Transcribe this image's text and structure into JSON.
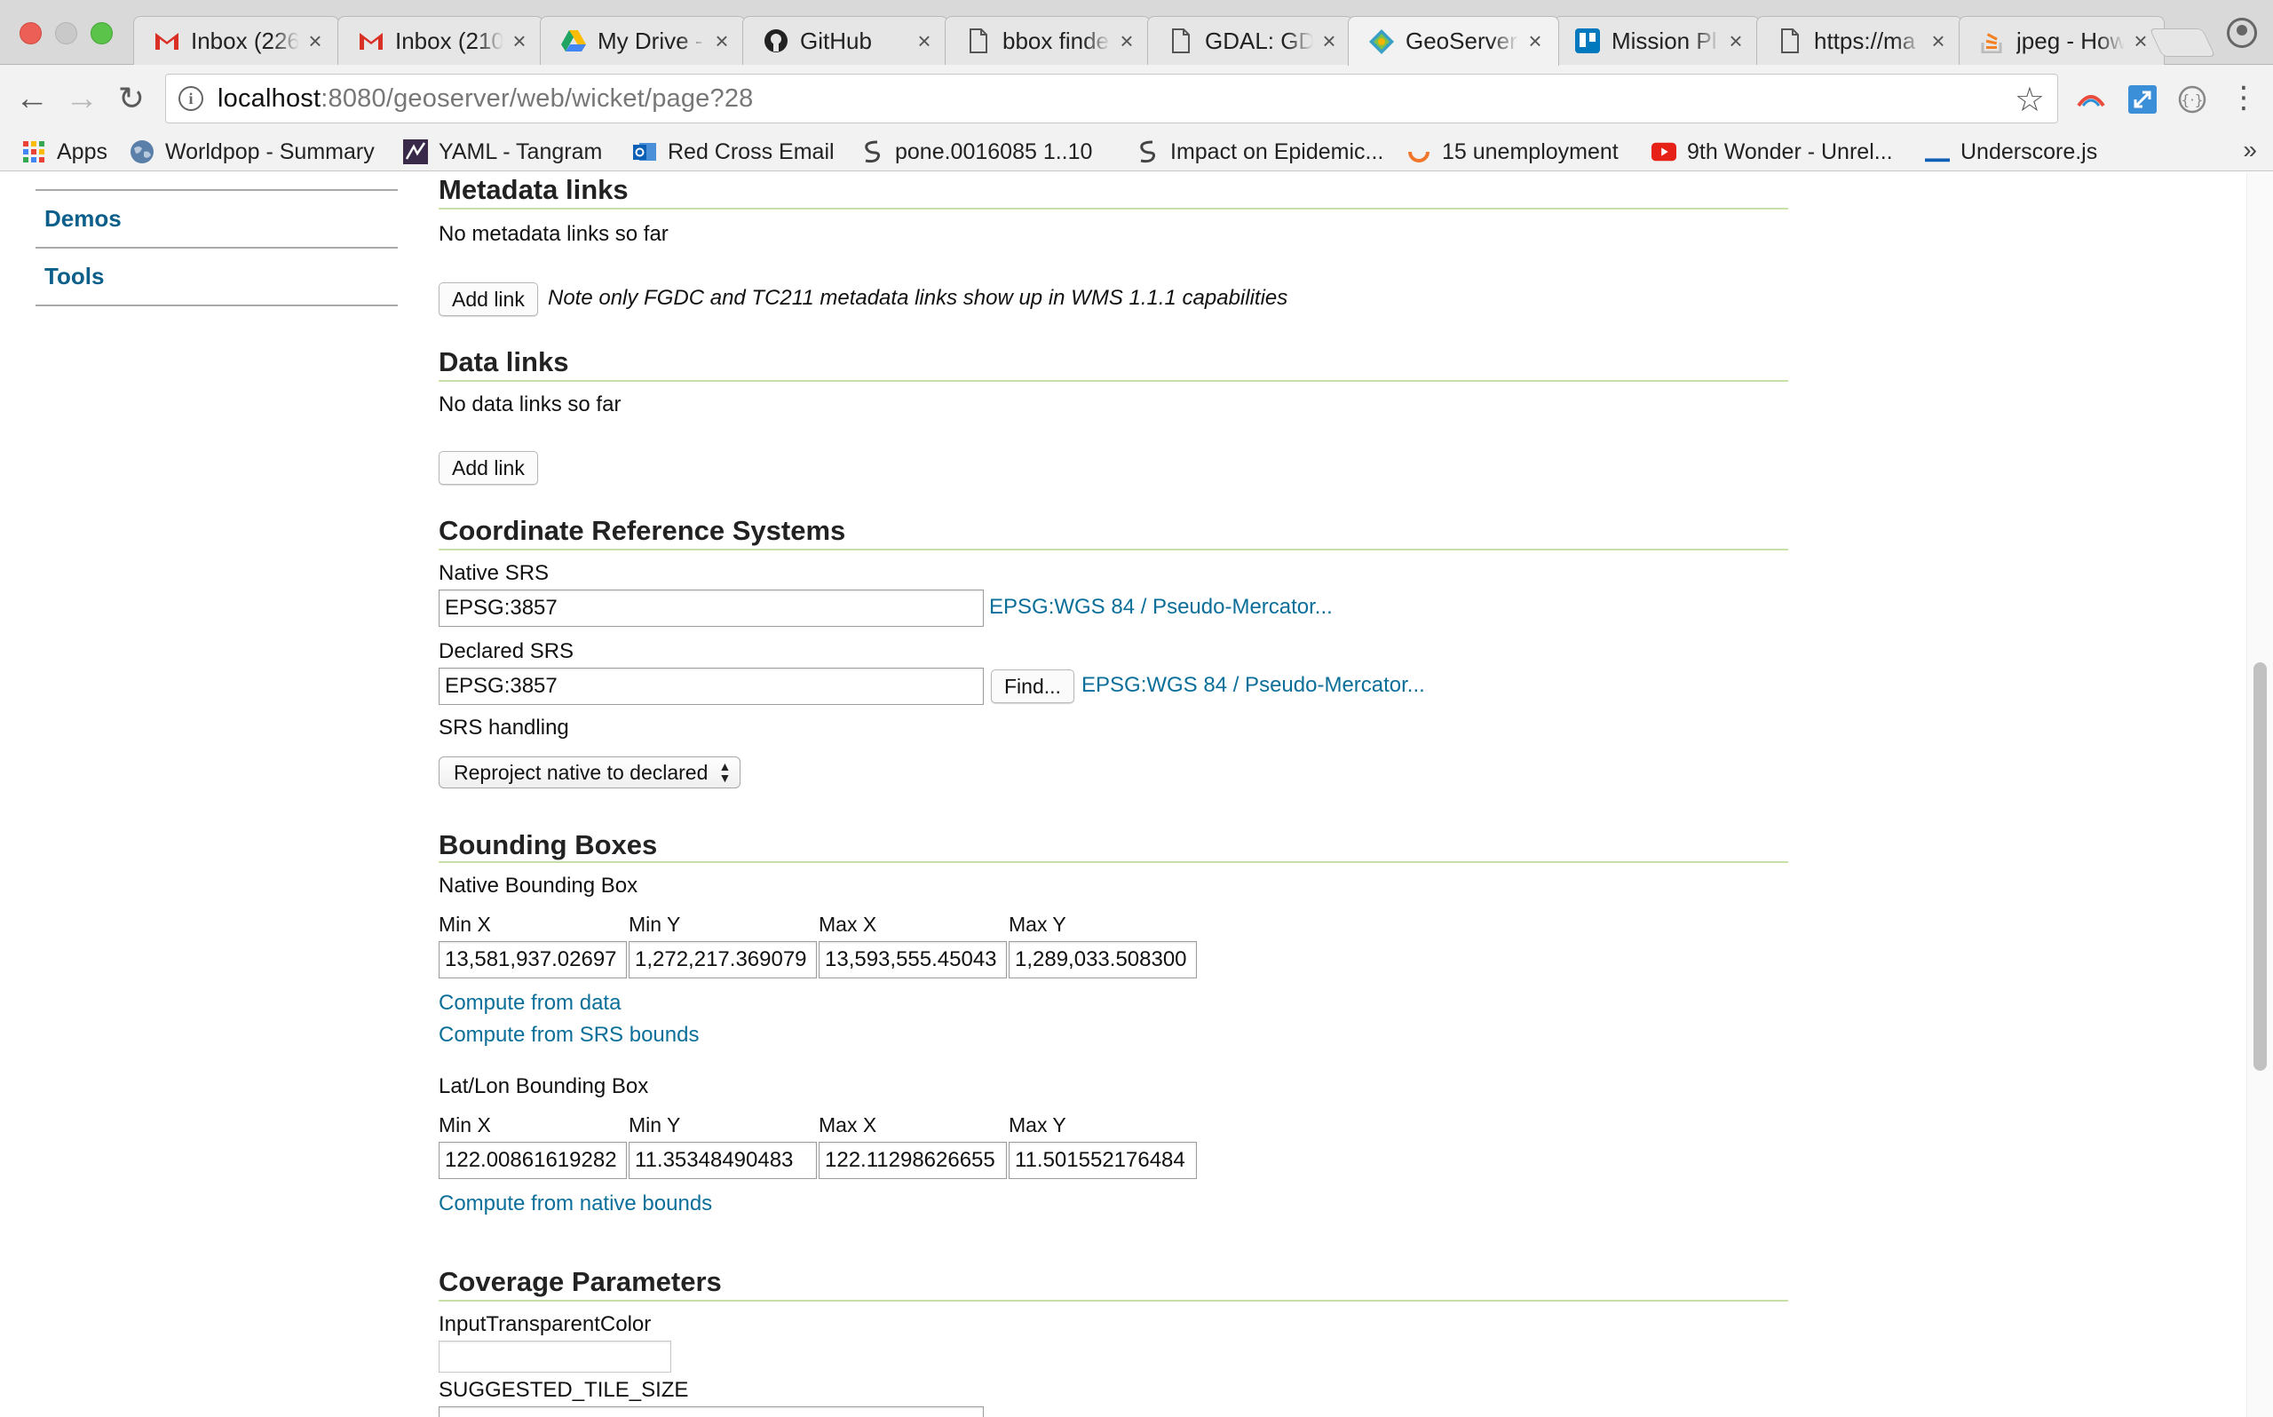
{
  "browser": {
    "tabs": [
      {
        "title": "Inbox (226",
        "icon": "gmail-icon",
        "active": false
      },
      {
        "title": "Inbox (210",
        "icon": "gmail-icon",
        "active": false
      },
      {
        "title": "My Drive -",
        "icon": "google-drive-icon",
        "active": false
      },
      {
        "title": "GitHub",
        "icon": "github-icon",
        "active": false
      },
      {
        "title": "bbox finde",
        "icon": "document-icon",
        "active": false
      },
      {
        "title": "GDAL: GD",
        "icon": "document-icon",
        "active": false
      },
      {
        "title": "GeoServer",
        "icon": "geoserver-icon",
        "active": true
      },
      {
        "title": "Mission Pl",
        "icon": "trello-icon",
        "active": false
      },
      {
        "title": "https://ma",
        "icon": "document-icon",
        "active": false
      },
      {
        "title": "jpeg - How",
        "icon": "stackoverflow-icon",
        "active": false
      }
    ],
    "url_host": "localhost",
    "url_rest": ":8080/geoserver/web/wicket/page?28",
    "bookmarks": [
      {
        "label": "Apps",
        "icon": "apps-grid-icon"
      },
      {
        "label": "Worldpop - Summary",
        "icon": "globe-icon"
      },
      {
        "label": "YAML - Tangram",
        "icon": "tangram-icon"
      },
      {
        "label": "Red Cross Email",
        "icon": "outlook-icon"
      },
      {
        "label": "pone.0016085 1..10",
        "icon": "plos-icon"
      },
      {
        "label": "Impact on Epidemic...",
        "icon": "plos-icon"
      },
      {
        "label": "15 unemployment",
        "icon": "spinner-icon"
      },
      {
        "label": "9th Wonder - Unrel...",
        "icon": "youtube-icon"
      },
      {
        "label": "Underscore.js",
        "icon": "underscore-icon"
      }
    ],
    "more_bookmarks": "»"
  },
  "sidebar": {
    "items": [
      {
        "label": "Demos"
      },
      {
        "label": "Tools"
      }
    ]
  },
  "metadata_links": {
    "heading": "Metadata links",
    "empty_text": "No metadata links so far",
    "add_button": "Add link",
    "note": "Note only FGDC and TC211 metadata links show up in WMS 1.1.1 capabilities"
  },
  "data_links": {
    "heading": "Data links",
    "empty_text": "No data links so far",
    "add_button": "Add link"
  },
  "crs": {
    "heading": "Coordinate Reference Systems",
    "native_label": "Native SRS",
    "native_value": "EPSG:3857",
    "native_link": "EPSG:WGS 84 / Pseudo-Mercator...",
    "declared_label": "Declared SRS",
    "declared_value": "EPSG:3857",
    "find_button": "Find...",
    "declared_link": "EPSG:WGS 84 / Pseudo-Mercator...",
    "handling_label": "SRS handling",
    "handling_value": "Reproject native to declared"
  },
  "bounding_boxes": {
    "heading": "Bounding Boxes",
    "native": {
      "label": "Native Bounding Box",
      "min_x_label": "Min X",
      "min_y_label": "Min Y",
      "max_x_label": "Max X",
      "max_y_label": "Max Y",
      "min_x": "13,581,937.02697",
      "min_y": "1,272,217.369079",
      "max_x": "13,593,555.45043",
      "max_y": "1,289,033.508300"
    },
    "compute_from_data": "Compute from data",
    "compute_from_srs": "Compute from SRS bounds",
    "latlon": {
      "label": "Lat/Lon Bounding Box",
      "min_x_label": "Min X",
      "min_y_label": "Min Y",
      "max_x_label": "Max X",
      "max_y_label": "Max Y",
      "min_x": "122.00861619282",
      "min_y": "11.35348490483",
      "max_x": "122.11298626655",
      "max_y": "11.501552176484"
    },
    "compute_from_native": "Compute from native bounds"
  },
  "coverage": {
    "heading": "Coverage Parameters",
    "transparent_label": "InputTransparentColor",
    "transparent_value": "",
    "tile_size_label": "SUGGESTED_TILE_SIZE"
  }
}
